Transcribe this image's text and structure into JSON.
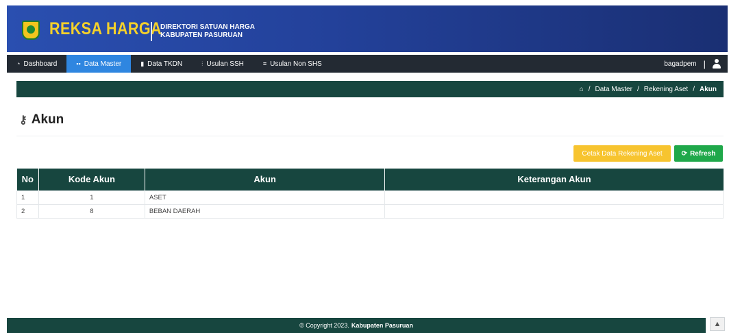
{
  "header": {
    "app_title": "REKSA HARGA",
    "subtitle_line1": "DIREKTORI SATUAN HARGA",
    "subtitle_line2": "KABUPATEN PASURUAN"
  },
  "nav": {
    "items": [
      {
        "label": "Dashboard",
        "icon": "gauge-icon",
        "glyph": "◔"
      },
      {
        "label": "Data Master",
        "icon": "grid-icon",
        "glyph": "▪▪"
      },
      {
        "label": "Data TKDN",
        "icon": "book-icon",
        "glyph": "▮"
      },
      {
        "label": "Usulan SSH",
        "icon": "sitemap-icon",
        "glyph": "⫶"
      },
      {
        "label": "Usulan Non SHS",
        "icon": "server-icon",
        "glyph": "≡"
      }
    ],
    "active_index": 1,
    "username": "bagadpem"
  },
  "breadcrumb": {
    "home_icon": "home-icon",
    "items": [
      "Data Master",
      "Rekening Aset",
      "Akun"
    ],
    "separator": "/"
  },
  "page": {
    "title": "Akun",
    "title_icon": "key-icon"
  },
  "actions": {
    "print_label": "Cetak Data Rekening Aset",
    "refresh_label": "Refresh",
    "refresh_icon": "refresh-icon"
  },
  "table": {
    "columns": [
      "No",
      "Kode Akun",
      "Akun",
      "Keterangan Akun"
    ],
    "rows": [
      [
        "1",
        "1",
        "ASET",
        ""
      ],
      [
        "2",
        "8",
        "BEBAN DAERAH",
        ""
      ]
    ]
  },
  "footer": {
    "copyright": "© Copyright 2023.",
    "owner": "Kabupaten Pasuruan"
  },
  "colors": {
    "banner": "#23419a",
    "accent_yellow": "#f5d12a",
    "dark_green": "#17463f",
    "nav_bg": "#232a33",
    "active_blue": "#2f86e0",
    "print_btn": "#f7c42f",
    "refresh_btn": "#1fa84a"
  }
}
